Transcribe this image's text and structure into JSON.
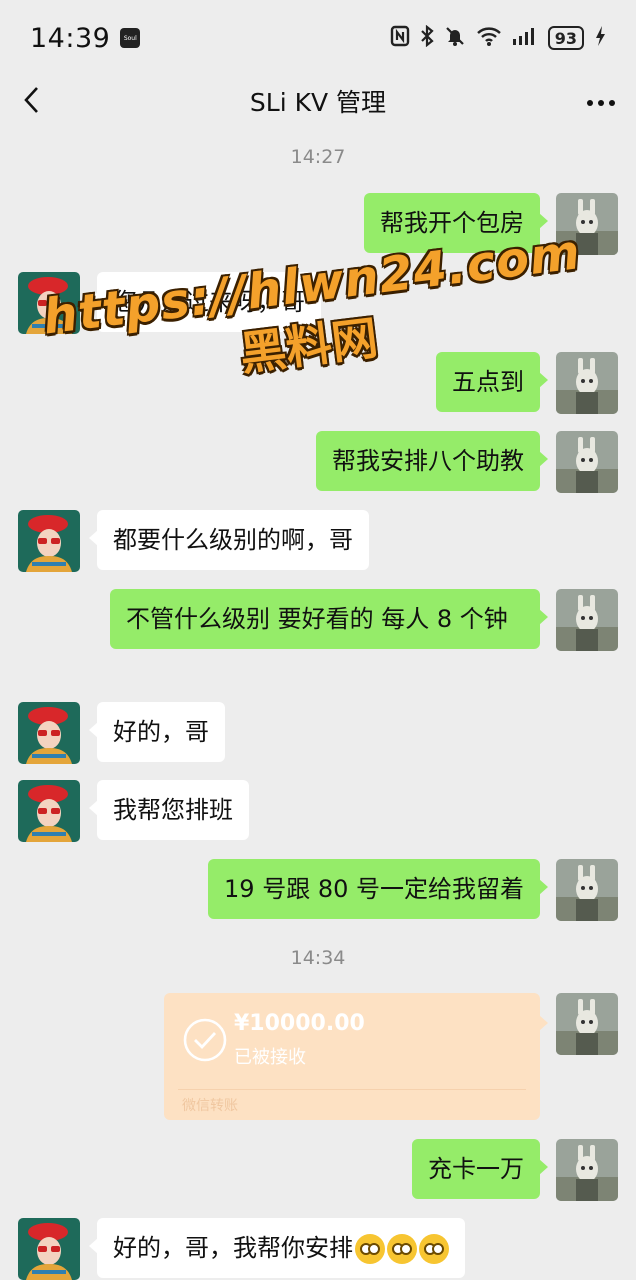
{
  "status_bar": {
    "time": "14:39",
    "app_badge": "Soul",
    "battery": "93"
  },
  "header": {
    "title": "SLi KV 管理"
  },
  "timestamps": [
    "14:27",
    "14:34"
  ],
  "messages": [
    {
      "from": "me",
      "text": "帮我开个包房"
    },
    {
      "from": "them",
      "text": "您几点过来呀，哥"
    },
    {
      "from": "me",
      "text": "五点到"
    },
    {
      "from": "me",
      "text": "帮我安排八个助教"
    },
    {
      "from": "them",
      "text": "都要什么级别的啊，哥"
    },
    {
      "from": "me",
      "text": "不管什么级别 要好看的 每人 8 个钟"
    },
    {
      "from": "them",
      "text": "好的，哥"
    },
    {
      "from": "them",
      "text": "我帮您排班"
    },
    {
      "from": "me",
      "text": "19 号跟 80 号一定给我留着"
    },
    {
      "from": "me",
      "text": "充卡一万"
    },
    {
      "from": "them",
      "text": "好的，哥，我帮你安排"
    }
  ],
  "transfer": {
    "amount": "¥10000.00",
    "status": "已被接收",
    "footer": "微信转账"
  },
  "watermark": {
    "line1": "https://hlwn24.com",
    "line2": "黑料网"
  },
  "colors": {
    "sent_bubble": "#95ec69",
    "received_bubble": "#ffffff",
    "transfer_card": "#fde1c3",
    "watermark": "#f4a12b"
  }
}
